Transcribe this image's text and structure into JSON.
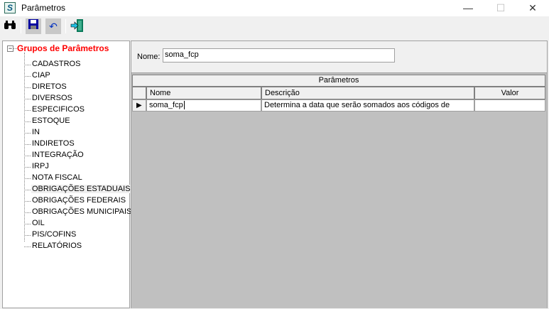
{
  "window": {
    "title": "Parâmetros",
    "app_icon": "S",
    "minimize": "—",
    "maximize": "☐",
    "close": "✕"
  },
  "toolbar": {
    "search_icon": "binoculars-icon",
    "save_icon": "floppy-disk-icon",
    "undo_icon": "undo-icon",
    "exit_icon": "exit-door-icon"
  },
  "tree": {
    "root": "Grupos de Parâmetros",
    "expander": "−",
    "items": [
      "CADASTROS",
      "CIAP",
      "DIRETOS",
      "DIVERSOS",
      "ESPECIFICOS",
      "ESTOQUE",
      "IN",
      "INDIRETOS",
      "INTEGRAÇÃO",
      "IRPJ",
      "NOTA FISCAL",
      "OBRIGAÇÕES ESTADUAIS",
      "OBRIGAÇÕES FEDERAIS",
      "OBRIGAÇÕES MUNICIPAIS",
      "OIL",
      "PIS/COFINS",
      "RELATÓRIOS"
    ],
    "selected": "OBRIGAÇÕES ESTADUAIS"
  },
  "form": {
    "name_label": "Nome:",
    "name_value": "soma_fcp"
  },
  "grid": {
    "title": "Parâmetros",
    "columns": [
      "Nome",
      "Descrição",
      "Valor"
    ],
    "rows": [
      {
        "indicator": "▶",
        "nome": "soma_fcp",
        "descricao": "Determina a data que serão somados aos códigos de",
        "valor": ""
      }
    ]
  }
}
